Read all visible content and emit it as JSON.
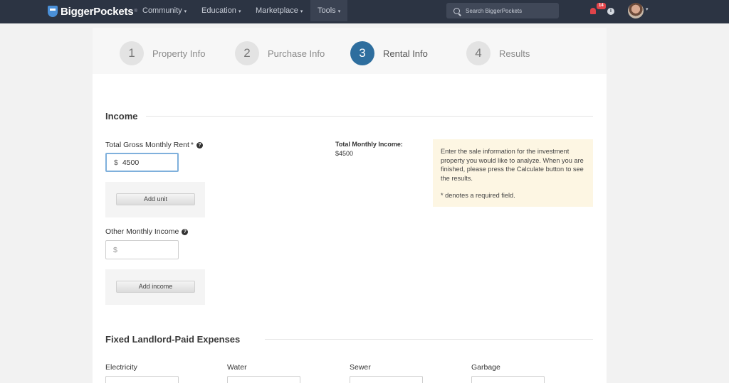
{
  "brand": {
    "name": "BiggerPockets",
    "reg": "®"
  },
  "nav": {
    "items": [
      "Community",
      "Education",
      "Marketplace",
      "Tools"
    ],
    "caret": "▾",
    "search_placeholder": "Search BiggerPockets",
    "notification_count": "14",
    "info_glyph": "i"
  },
  "steps": [
    {
      "num": "1",
      "label": "Property Info"
    },
    {
      "num": "2",
      "label": "Purchase Info"
    },
    {
      "num": "3",
      "label": "Rental Info"
    },
    {
      "num": "4",
      "label": "Results"
    }
  ],
  "income": {
    "title": "Income",
    "gross_rent": {
      "label": "Total Gross Monthly Rent",
      "required": "*",
      "prefix": "$",
      "value": "4500"
    },
    "add_unit": "Add unit",
    "other_income": {
      "label": "Other Monthly Income",
      "prefix": "$",
      "placeholder": ""
    },
    "add_income": "Add income",
    "total_label": "Total Monthly Income:",
    "total_value": "$4500",
    "help_glyph": "?"
  },
  "note": {
    "text": "Enter the sale information for the investment property you would like to analyze. When you are finished, please press the Calculate button to see the results.",
    "required_text": "* denotes a required field."
  },
  "expenses": {
    "title": "Fixed Landlord-Paid Expenses",
    "fields": [
      "Electricity",
      "Water",
      "Sewer",
      "Garbage"
    ]
  },
  "colors": {
    "nav_bg": "#2c3443",
    "active_step": "#2e6e9e",
    "note_bg": "#fdf6e3",
    "alert": "#e0444a"
  }
}
